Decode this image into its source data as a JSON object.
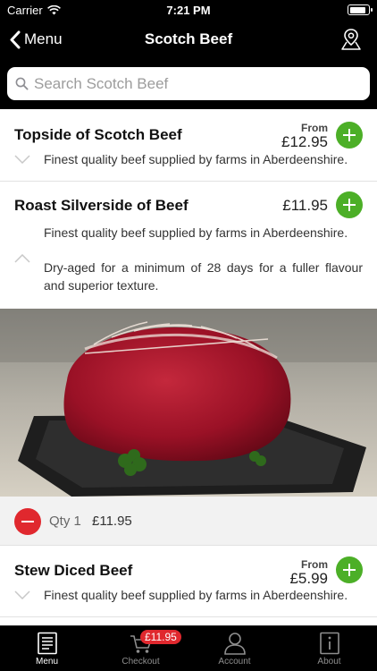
{
  "status_bar": {
    "carrier": "Carrier",
    "time": "7:21 PM"
  },
  "nav": {
    "back_label": "Menu",
    "title": "Scotch Beef"
  },
  "search": {
    "placeholder": "Search Scotch Beef",
    "value": ""
  },
  "products": [
    {
      "name": "Topside of Scotch Beef",
      "from_label": "From",
      "price": "£12.95",
      "description": "Finest quality beef supplied by farms in Aberdeenshire."
    },
    {
      "name": "Roast Silverside of Beef",
      "price": "£11.95",
      "description": "Finest quality beef supplied by farms in Aberdeenshire.",
      "extra_description": "Dry-aged for a minimum of 28 days for a fuller flavour and superior texture.",
      "cart": {
        "qty_label": "Qty 1",
        "qty_price": "£11.95"
      }
    },
    {
      "name": "Stew Diced Beef",
      "from_label": "From",
      "price": "£5.99",
      "description": "Finest quality beef supplied by farms in Aberdeenshire."
    }
  ],
  "tabs": [
    {
      "label": "Menu",
      "icon": "menu-book-icon",
      "active": true
    },
    {
      "label": "Checkout",
      "icon": "cart-icon",
      "badge": "£11.95"
    },
    {
      "label": "Account",
      "icon": "person-icon"
    },
    {
      "label": "About",
      "icon": "info-icon"
    }
  ],
  "colors": {
    "add": "#4caf27",
    "remove": "#e0282e",
    "bar": "#000000"
  }
}
